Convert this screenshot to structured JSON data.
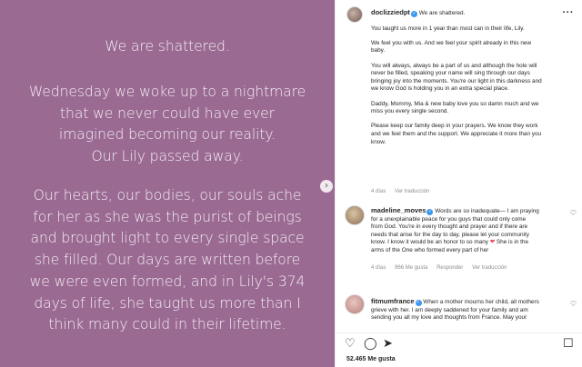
{
  "post_image": {
    "title": "We are shattered.",
    "para1_lines": [
      "Wednesday we woke up to a nightmare",
      "that we never could have ever",
      "imagined becoming our reality.",
      "Our Lily passed away."
    ],
    "para2_lines": [
      "Our hearts, our bodies, our souls ache",
      "for her as she was the purist of beings",
      "and brought light to every single space",
      "she filled. Our days are written before",
      "we were even formed, and in Lily's 374",
      "days of life, she taught us more than I",
      "think many could in their lifetime."
    ],
    "background_color": "#9a6a93"
  },
  "header": {
    "username": "doclizziedpt",
    "caption_first": "We are shattered."
  },
  "caption": {
    "p1": [
      "You taught us more in 1 year than most can in their life, Lily."
    ],
    "p2": [
      "We feel you with us. And we feel your spirit already in this new",
      "baby."
    ],
    "p3": [
      "You will always, always be a part of us and although the hole will",
      "never be filled, speaking your name will sing through our days",
      "bringing joy into the moments. You're our light in this darkness and",
      "we know God is holding you in an extra special place."
    ],
    "p4": [
      "Daddy, Mommy, Mia & new baby love you so damn much and we",
      "miss you every single second."
    ],
    "p5": [
      "Please keep our family deep in your prayers. We know they work",
      "and we feel them and the support. We appreciate it more than you",
      "know."
    ]
  },
  "caption_meta": {
    "age": "4 días",
    "translate": "Ver traducción"
  },
  "comment1": {
    "username": "madeline_moves",
    "lines": [
      "Words are so inadequate— I am praying",
      "for a unexplainable peace for you guys that could only come",
      "from God. You're in every thought and prayer and if there are",
      "needs that arise for the day to day, please let your community",
      "know. I know it would be an honor to so many",
      "She is in the",
      "arms of the One who formed every part of her"
    ],
    "age": "4 días",
    "likes": "966 Me gusta",
    "reply": "Responder",
    "translate": "Ver traducción"
  },
  "comment2": {
    "username": "fitmumfrance",
    "lines": [
      "When a mother mourns her child, all mothers",
      "grieve with her. I am deeply saddened for your family and am",
      "sending you all my love and thoughts from France. May your"
    ]
  },
  "footer": {
    "likes": "52.465 Me gusta"
  },
  "icons": {
    "more": "more-horizontal-icon",
    "heart": "heart-icon",
    "comment": "comment-icon",
    "share": "share-icon",
    "save": "bookmark-icon",
    "verified": "verified-badge-icon",
    "carousel": "chevron-right-icon"
  }
}
